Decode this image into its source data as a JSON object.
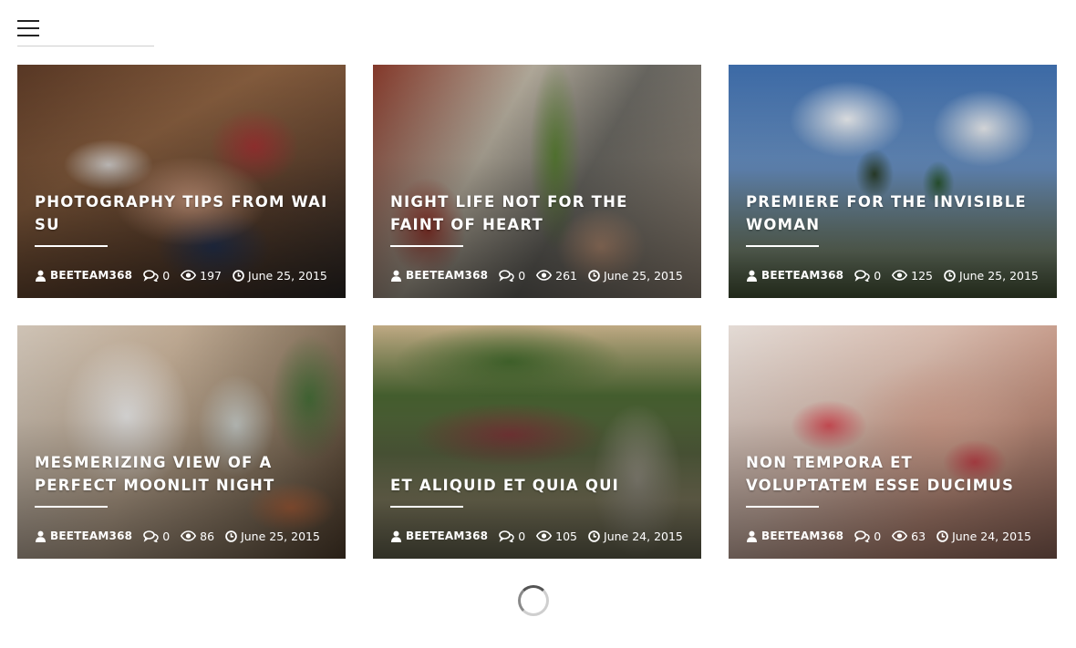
{
  "header": {
    "menu_icon": "hamburger-menu-icon"
  },
  "posts": [
    {
      "title": "Photography Tips From Wai Su",
      "author": "BEETEAM368",
      "comments": "0",
      "views": "197",
      "date": "June 25, 2015"
    },
    {
      "title": "Night Life Not for the Faint of Heart",
      "author": "BEETEAM368",
      "comments": "0",
      "views": "261",
      "date": "June 25, 2015"
    },
    {
      "title": "Premiere for The Invisible Woman",
      "author": "BEETEAM368",
      "comments": "0",
      "views": "125",
      "date": "June 25, 2015"
    },
    {
      "title": "Mesmerizing View of a Perfect Moonlit Night",
      "author": "BEETEAM368",
      "comments": "0",
      "views": "86",
      "date": "June 25, 2015"
    },
    {
      "title": "Et aliquid et quia qui",
      "author": "BEETEAM368",
      "comments": "0",
      "views": "105",
      "date": "June 24, 2015"
    },
    {
      "title": "Non tempora et voluptatem esse ducimus",
      "author": "BEETEAM368",
      "comments": "0",
      "views": "63",
      "date": "June 24, 2015"
    }
  ],
  "icons": {
    "author": "user-icon",
    "comments": "comments-icon",
    "views": "eye-icon",
    "date": "clock-icon",
    "loading": "loading-spinner-icon"
  },
  "colors": {
    "overlay_text": "#ffffff",
    "background": "#ffffff"
  }
}
